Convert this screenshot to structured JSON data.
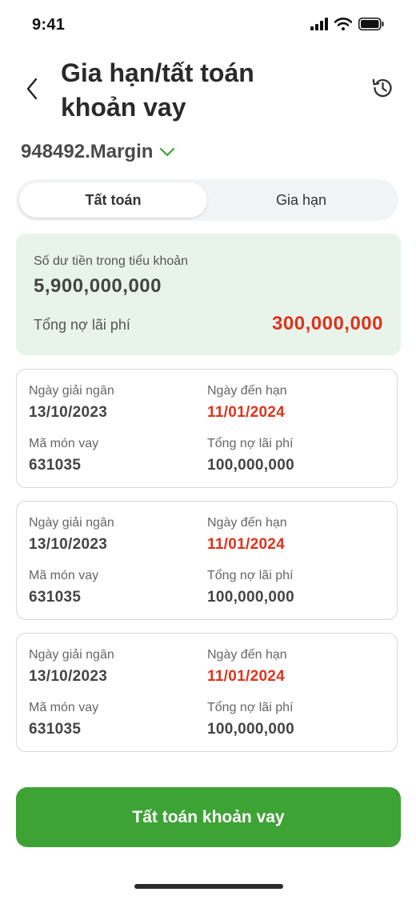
{
  "status": {
    "time": "9:41"
  },
  "header": {
    "title_line1": "Gia hạn/tất toán",
    "title_line2": "khoản vay"
  },
  "account": {
    "label": "948492.Margin"
  },
  "tabs": [
    {
      "label": "Tất toán",
      "active": true
    },
    {
      "label": "Gia hạn",
      "active": false
    }
  ],
  "summary": {
    "balance_label": "Số dư tiền trong tiểu khoản",
    "balance_value": "5,900,000,000",
    "debt_label": "Tổng nợ lãi phí",
    "debt_value": "300,000,000"
  },
  "loans": [
    {
      "disburse_label": "Ngày giải ngân",
      "disburse_date": "13/10/2023",
      "due_label": "Ngày đến hạn",
      "due_date": "11/01/2024",
      "code_label": "Mã món vay",
      "code": "631035",
      "debt_label": "Tổng nợ lãi phí",
      "debt": "100,000,000"
    },
    {
      "disburse_label": "Ngày giải ngân",
      "disburse_date": "13/10/2023",
      "due_label": "Ngày đến hạn",
      "due_date": "11/01/2024",
      "code_label": "Mã món vay",
      "code": "631035",
      "debt_label": "Tổng nợ lãi phí",
      "debt": "100,000,000"
    },
    {
      "disburse_label": "Ngày giải ngân",
      "disburse_date": "13/10/2023",
      "due_label": "Ngày đến hạn",
      "due_date": "11/01/2024",
      "code_label": "Mã món vay",
      "code": "631035",
      "debt_label": "Tổng nợ lãi phí",
      "debt": "100,000,000"
    }
  ],
  "action": {
    "label": "Tất toán khoản vay"
  },
  "icons": {
    "back": "chevron-left-icon",
    "history": "history-icon",
    "dropdown": "chevron-down-icon",
    "signal": "signal-icon",
    "wifi": "wifi-icon",
    "battery": "battery-icon"
  },
  "colors": {
    "accent_green": "#3ea335",
    "summary_bg": "#e8f4ea",
    "alert_red": "#e0321e"
  }
}
